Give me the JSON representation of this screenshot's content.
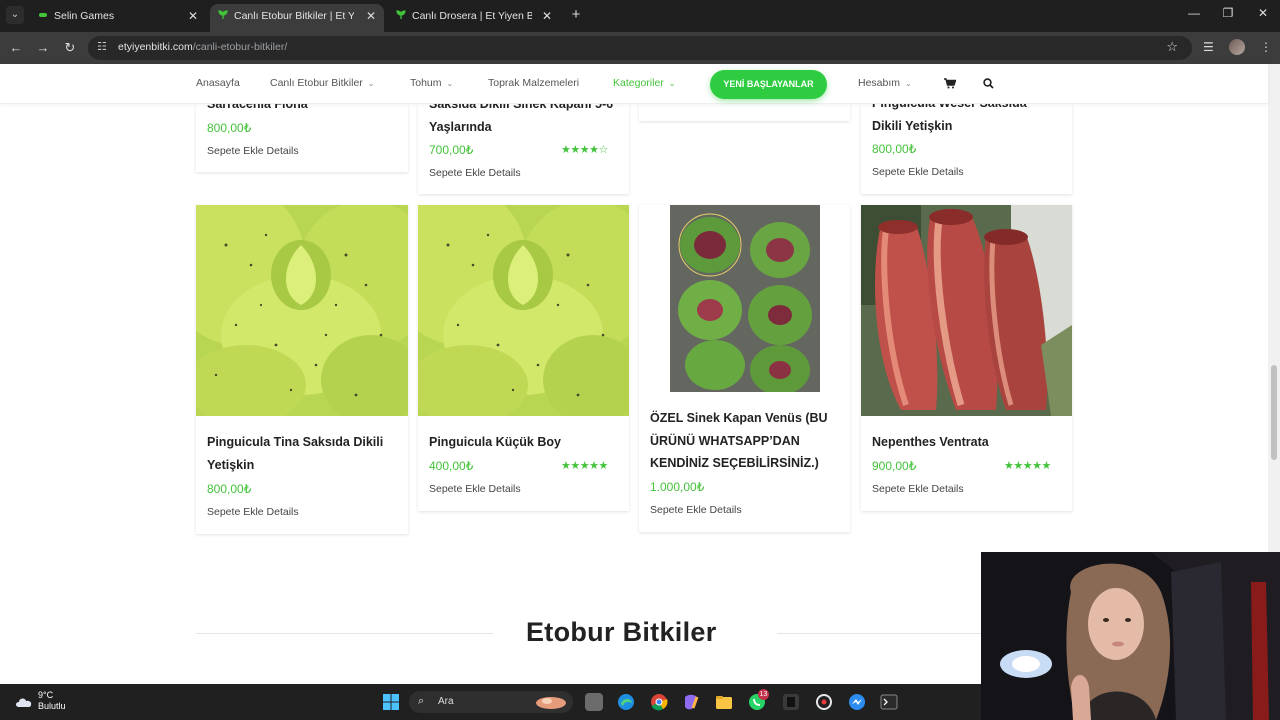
{
  "browser": {
    "tabs": [
      {
        "title": "Selin Games",
        "active": false
      },
      {
        "title": "Canlı Etobur Bitkiler | Et Yiyen Bitki",
        "active": true
      },
      {
        "title": "Canlı Drosera | Et Yiyen Bitki",
        "active": false
      }
    ],
    "url_domain": "etyiyenbitki.com",
    "url_path": "/canli-etobur-bitkiler/"
  },
  "site_nav": {
    "items": [
      "Anasayfa",
      "Canlı Etobur Bitkiler",
      "Tohum",
      "Toprak Malzemeleri",
      "Kategoriler"
    ],
    "cta": "YENİ BAŞLAYANLAR",
    "account": "Hesabım"
  },
  "products_top": [
    {
      "title": "Sarracenia Flona",
      "price": "800,00₺",
      "links": "Sepete Ekle Details"
    },
    {
      "title_line1": "Saksıda Dikili Sinek Kapanı 5-6",
      "title_line2": "Yaşlarında",
      "price": "700,00₺",
      "rating": 4.5,
      "links": "Sepete Ekle Details"
    },
    {
      "title_line1": "Pinguicula Weser Saksıda",
      "title_line2": "Dikili Yetişkin",
      "price": "800,00₺",
      "links": "Sepete Ekle Details"
    }
  ],
  "products": [
    {
      "title_line1": "Pinguicula Tina Saksıda Dikili",
      "title_line2": "Yetişkin",
      "price": "800,00₺",
      "links": "Sepete Ekle Details"
    },
    {
      "title": "Pinguicula Küçük Boy",
      "price": "400,00₺",
      "rating": 5,
      "links": "Sepete Ekle Details"
    },
    {
      "title_line1": "ÖZEL Sinek Kapan Venüs (BU",
      "title_line2": "ÜRÜNÜ WHATSAPP’DAN",
      "title_line3": "KENDİNİZ SEÇEBİLİRSİNİZ.)",
      "price": "1.000,00₺",
      "links": "Sepete Ekle Details"
    },
    {
      "title": "Nepenthes Ventrata",
      "price": "900,00₺",
      "rating": 5,
      "links": "Sepete Ekle Details"
    }
  ],
  "section_title": "Etobur Bitkiler",
  "stars": {
    "full": "★★★★★",
    "four_half": "★★★★☆"
  },
  "taskbar": {
    "temp": "9°C",
    "weather": "Bulutlu",
    "search": "Ara",
    "whatsapp_badge": "13"
  },
  "colors": {
    "accent_green": "#43c33a",
    "cta_green": "#2ecc40",
    "chrome_dark": "#1f1f1f"
  }
}
